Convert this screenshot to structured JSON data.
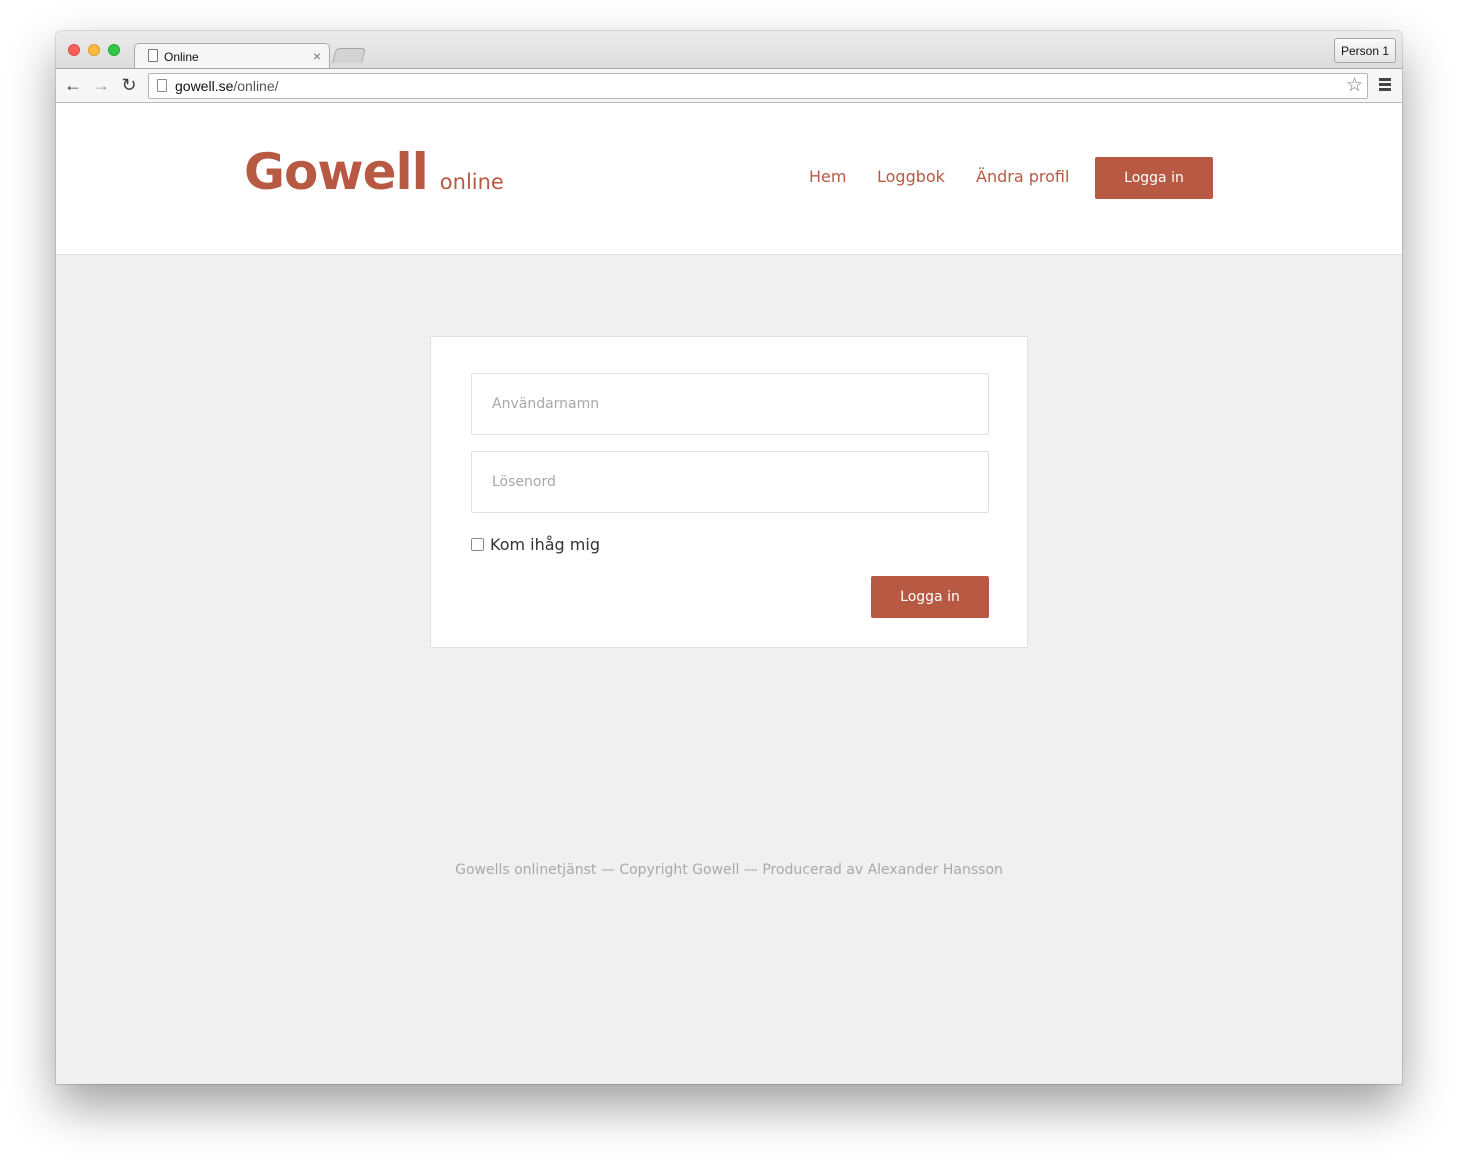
{
  "browser": {
    "tab_title": "Online",
    "tab_close": "×",
    "profile_label": "Person 1",
    "url_host": "gowell.se",
    "url_path": "/online/"
  },
  "header": {
    "logo_main": "Gowell",
    "logo_sub": "online",
    "nav": [
      {
        "label": "Hem"
      },
      {
        "label": "Loggbok"
      },
      {
        "label": "Ändra profil"
      }
    ],
    "login_button": "Logga in"
  },
  "login_form": {
    "username_placeholder": "Användarnamn",
    "password_placeholder": "Lösenord",
    "remember_label": "Kom ihåg mig",
    "remember_checked": false,
    "submit_label": "Logga in"
  },
  "footer": {
    "text": "Gowells onlinetjänst — Copyright Gowell — Producerad av Alexander Hansson"
  },
  "colors": {
    "brand": "#b85a43",
    "page_background": "#f0f0f0",
    "footer_text": "#a9a9a9"
  }
}
